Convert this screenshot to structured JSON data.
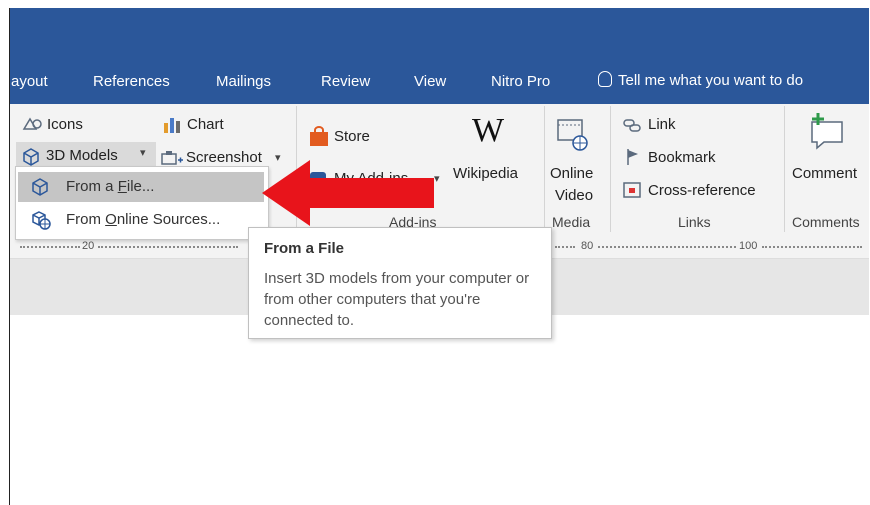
{
  "tabs": [
    {
      "label": "ayout",
      "left": 0
    },
    {
      "label": "References"
    },
    {
      "label": "Mailings"
    },
    {
      "label": "Review"
    },
    {
      "label": "View"
    },
    {
      "label": "Nitro Pro"
    }
  ],
  "tell_me": "Tell me what you want to do",
  "illustrations": {
    "icons": "Icons",
    "chart": "Chart",
    "models_3d": "3D Models",
    "screenshot": "Screenshot"
  },
  "addins": {
    "store": "Store",
    "my_addins": "My Add-ins",
    "wikipedia": "Wikipedia",
    "wiki_logo": "W",
    "group": "Add-ins"
  },
  "media": {
    "online_video_1": "Online",
    "online_video_2": "Video",
    "group": "Media"
  },
  "links": {
    "link": "Link",
    "bookmark": "Bookmark",
    "cross_reference": "Cross-reference",
    "group": "Links"
  },
  "comments": {
    "comment": "Comment",
    "group": "Comments"
  },
  "ruler": {
    "n20": "20",
    "n80": "80",
    "n100": "100"
  },
  "dropdown": {
    "from_file_pre": "From a ",
    "from_file_key": "F",
    "from_file_post": "ile...",
    "online_pre": "From ",
    "online_key": "O",
    "online_post": "nline Sources..."
  },
  "tooltip": {
    "title": "From a File",
    "body": "Insert 3D models from your computer or from other computers that you're connected to."
  },
  "colors": {
    "ribbon_blue": "#2b579a",
    "arrow_red": "#e8141b"
  }
}
